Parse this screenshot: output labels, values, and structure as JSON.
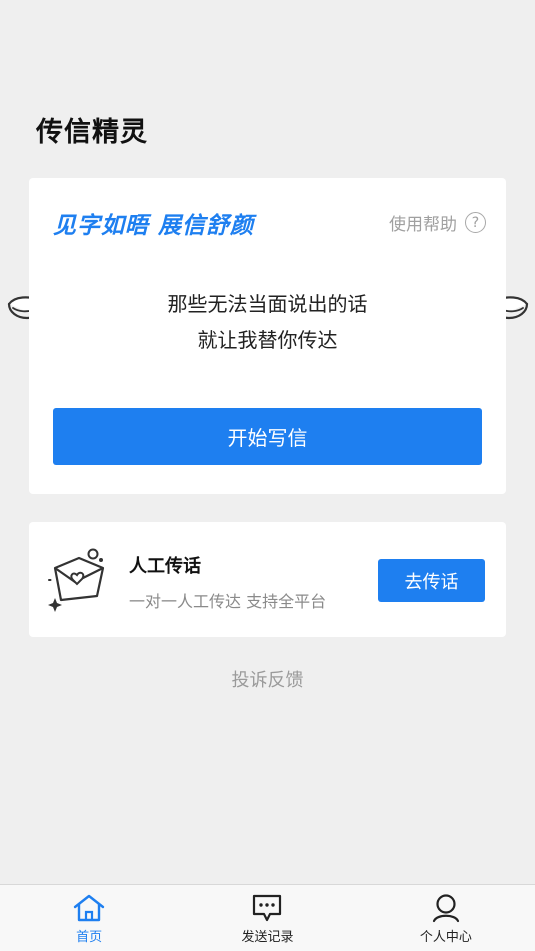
{
  "header": {
    "title": "传信精灵"
  },
  "main_card": {
    "slogan": "见字如晤 展信舒颜",
    "help_label": "使用帮助",
    "help_glyph": "?",
    "message_line1": "那些无法当面说出的话",
    "message_line2": "就让我替你传达",
    "start_button": "开始写信"
  },
  "human_card": {
    "title": "人工传话",
    "subtitle": "一对一人工传达 支持全平台",
    "button": "去传话"
  },
  "feedback": "投诉反馈",
  "bottom_nav": {
    "items": [
      {
        "label": "首页",
        "icon": "home-icon",
        "active": true
      },
      {
        "label": "发送记录",
        "icon": "message-icon",
        "active": false
      },
      {
        "label": "个人中心",
        "icon": "person-icon",
        "active": false
      }
    ]
  },
  "colors": {
    "accent": "#1e7ff0",
    "background": "#efefef"
  }
}
